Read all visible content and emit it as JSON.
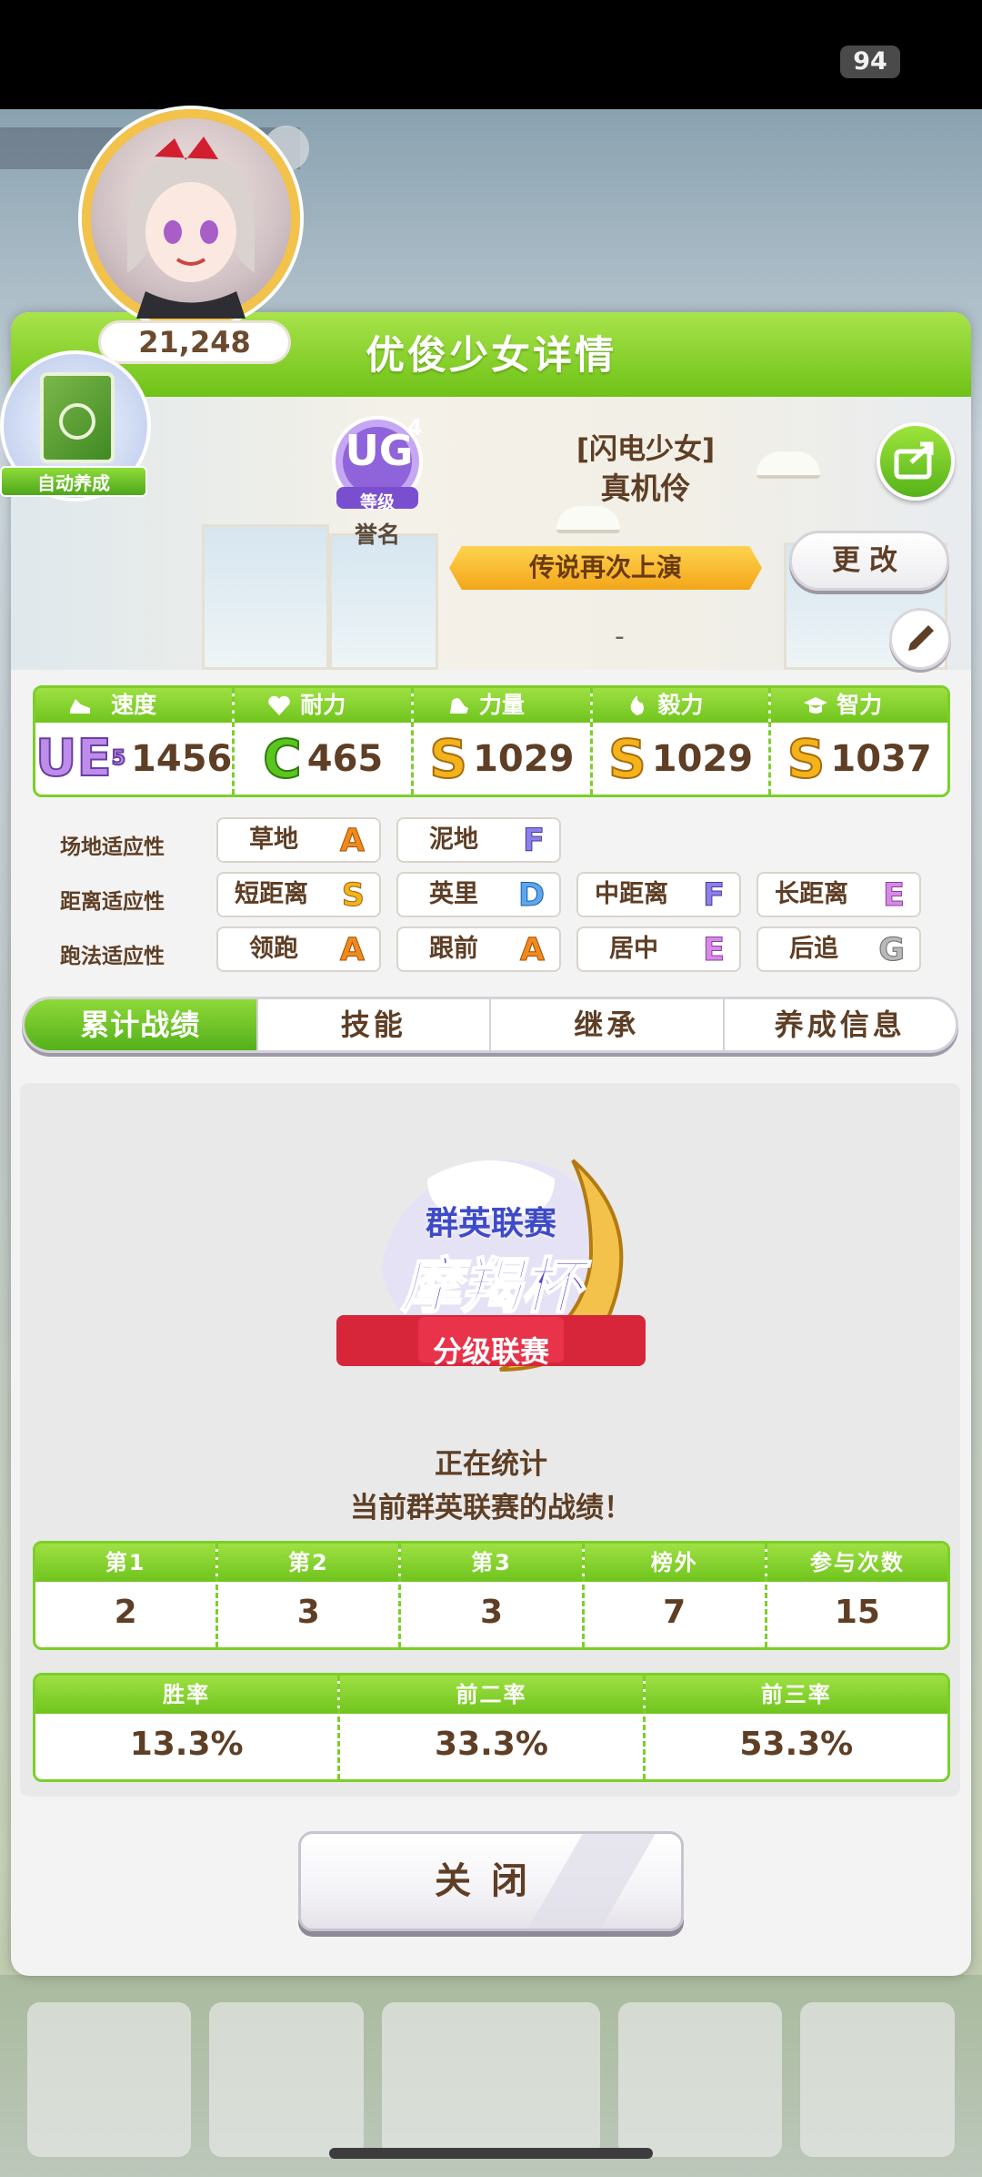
{
  "status_bar": {
    "battery": "94"
  },
  "dialog": {
    "title": "优俊少女详情",
    "auto_badge_label": "自动养成",
    "rank": {
      "badge_text": "UG",
      "badge_level": "4",
      "badge_sub": "等级",
      "caption": "誉名"
    },
    "character": {
      "epithet": "[闪电少女]",
      "name": "真机伶"
    },
    "title_banner": "传说再次上演",
    "change_button": "更改",
    "score": "21,248",
    "dash": "-",
    "stats": [
      {
        "label": "速度",
        "icon": "shoe-icon",
        "grade": "UE",
        "grade_sup": "5",
        "value": "1456"
      },
      {
        "label": "耐力",
        "icon": "heart-icon",
        "grade": "C",
        "value": "465"
      },
      {
        "label": "力量",
        "icon": "muscle-icon",
        "grade": "S",
        "value": "1029"
      },
      {
        "label": "毅力",
        "icon": "flame-icon",
        "grade": "S",
        "value": "1029"
      },
      {
        "label": "智力",
        "icon": "graduation-cap-icon",
        "grade": "S",
        "value": "1037"
      }
    ],
    "aptitude": {
      "track_label": "场地适应性",
      "track": [
        {
          "name": "草地",
          "grade": "A"
        },
        {
          "name": "泥地",
          "grade": "F"
        }
      ],
      "distance_label": "距离适应性",
      "distance": [
        {
          "name": "短距离",
          "grade": "S"
        },
        {
          "name": "英里",
          "grade": "D"
        },
        {
          "name": "中距离",
          "grade": "F"
        },
        {
          "name": "长距离",
          "grade": "E"
        }
      ],
      "style_label": "跑法适应性",
      "style": [
        {
          "name": "领跑",
          "grade": "A"
        },
        {
          "name": "跟前",
          "grade": "A"
        },
        {
          "name": "居中",
          "grade": "E"
        },
        {
          "name": "后追",
          "grade": "G"
        }
      ]
    },
    "tabs": [
      "累计战绩",
      "技能",
      "继承",
      "养成信息"
    ],
    "event": {
      "line1": "群英联赛",
      "line2": "摩羯杯",
      "line3": "分级联赛"
    },
    "message_line1": "正在统计",
    "message_line2": "当前群英联赛的战绩！",
    "results": {
      "headers": [
        "第1",
        "第2",
        "第3",
        "榜外",
        "参与次数"
      ],
      "values": [
        "2",
        "3",
        "3",
        "7",
        "15"
      ]
    },
    "rates": {
      "headers": [
        "胜率",
        "前二率",
        "前三率"
      ],
      "values": [
        "13.3%",
        "33.3%",
        "53.3%"
      ]
    },
    "close_button": "关闭"
  },
  "colors": {
    "accent_green": "#6fc218",
    "text_brown": "#5e3e25",
    "gold": "#f2b31b"
  }
}
